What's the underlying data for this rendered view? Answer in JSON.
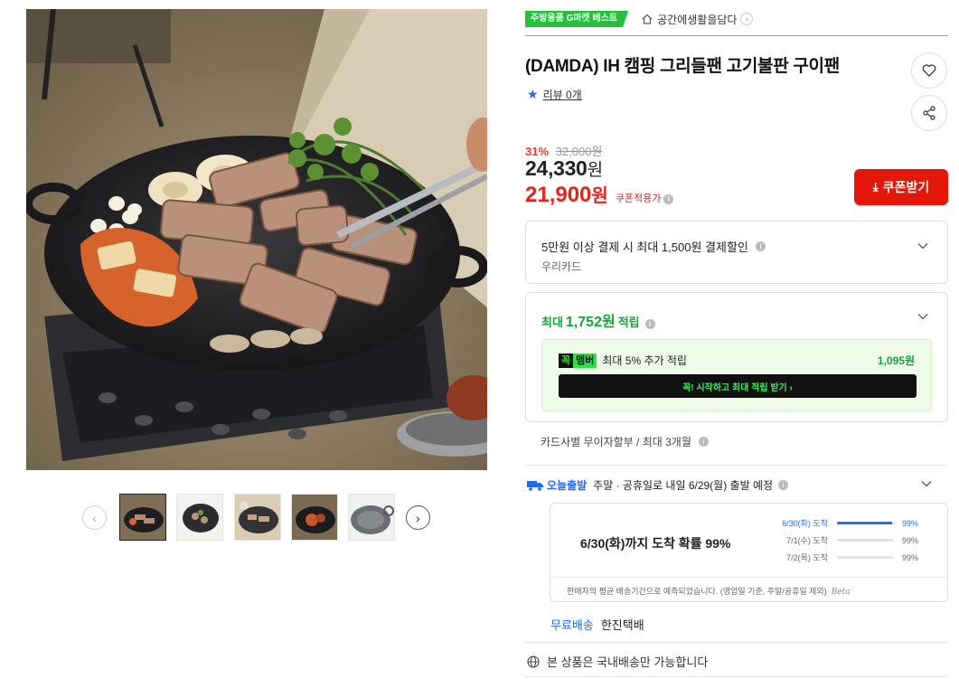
{
  "badge": {
    "label": "주방용품 G마켓 베스트"
  },
  "shop": {
    "name": "공간에생활을담다"
  },
  "product": {
    "title": "(DAMDA) IH 캠핑 그리들팬 고기불판 구이팬"
  },
  "review": {
    "label": "리뷰 0개"
  },
  "price": {
    "discount_rate": "31%",
    "original": "32,000원",
    "sale_amount": "24,330",
    "sale_unit": "원",
    "coupon_amount": "21,900",
    "coupon_unit": "원",
    "coupon_tag": "쿠폰적용가"
  },
  "coupon_button": {
    "label": "쿠폰받기"
  },
  "card_discount": {
    "title": "5만원 이상 결제 시 최대 1,500원 결제할인",
    "card": "우리카드"
  },
  "points": {
    "prefix": "최대",
    "amount": "1,752원",
    "suffix": "적립",
    "member_k": "꼭",
    "member_m": "멤버",
    "member_text": "최대 5% 추가 적립",
    "member_amount": "1,095원",
    "member_button": "꼭! 시작하고 최대 적립 받기  ›"
  },
  "installment": {
    "text": "카드사별 무이자할부 / 최대 3개월"
  },
  "shipping": {
    "today_label": "오늘출발",
    "schedule": "주말 · 공휴일로 내일 6/29(월) 출발 예정",
    "arrival_main": "6/30(화)까지 도착 확률 99%",
    "probabilities": [
      {
        "label": "6/30(화) 도착",
        "pct": "99%",
        "fill": 0.99
      },
      {
        "label": "7/1(수) 도착",
        "pct": "99%",
        "fill": 0
      },
      {
        "label": "7/2(목) 도착",
        "pct": "99%",
        "fill": 0
      }
    ],
    "note": "판매자의 평균 배송기간으로 예측되었습니다. (영업일 기준, 주말/공휴일 제외)",
    "beta": "Beta",
    "free_label": "무료배송",
    "courier": "한진택배"
  },
  "domestic": {
    "text": "본 상품은 국내배송만 가능합니다"
  },
  "gallery": {
    "thumb_count": 5,
    "active_index": 0
  },
  "colors": {
    "best_green": "#27c03d",
    "sale_red": "#e3241c",
    "coupon_btn": "#e3170a",
    "point_green": "#1aa13a",
    "ship_blue": "#1f6bff"
  }
}
